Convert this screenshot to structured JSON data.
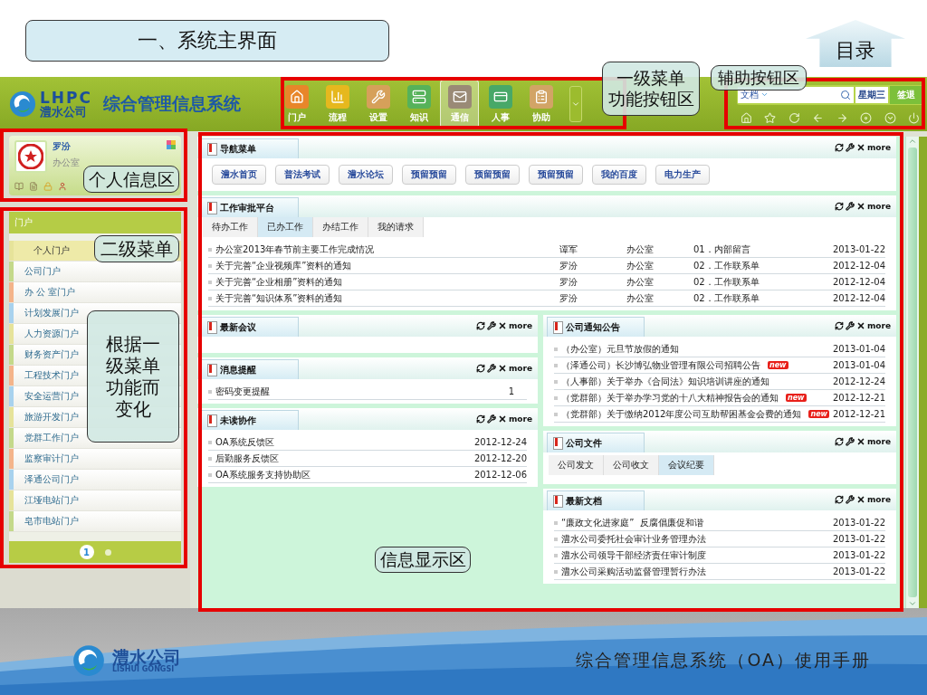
{
  "slide": {
    "title": "一、系统主界面",
    "toc": "目录"
  },
  "app": {
    "logo": {
      "mark": "LHPC",
      "name": "澧水公司"
    },
    "title": "综合管理信息系统",
    "main_menu": [
      {
        "label": "门户",
        "color": "#e8862a",
        "selected": false
      },
      {
        "label": "流程",
        "color": "#e6b81e",
        "selected": false
      },
      {
        "label": "设置",
        "color": "#d6a05a",
        "selected": false
      },
      {
        "label": "知识",
        "color": "#56b25a",
        "selected": false
      },
      {
        "label": "通信",
        "color": "#9a8a76",
        "selected": true
      },
      {
        "label": "人事",
        "color": "#48a868",
        "selected": false
      },
      {
        "label": "协助",
        "color": "#d2a466",
        "selected": false
      }
    ],
    "tools": {
      "search_scope": "文档",
      "weekday": "星期三",
      "sign_out": "签退"
    },
    "user": {
      "name": "罗汾",
      "department": "办公室"
    },
    "side_menu": {
      "title": "门户",
      "items": [
        {
          "label": "个人门户",
          "selected": true,
          "color": "#e6e39a"
        },
        {
          "label": "公司门户",
          "selected": false,
          "color": "#c4d98a"
        },
        {
          "label": "办 公 室门户",
          "selected": false,
          "color": "#f4b48a"
        },
        {
          "label": "计划发展门户",
          "selected": false,
          "color": "#a8d2ee"
        },
        {
          "label": "人力资源门户",
          "selected": false,
          "color": "#e6e39a"
        },
        {
          "label": "财务资产门户",
          "selected": false,
          "color": "#c4d98a"
        },
        {
          "label": "工程技术门户",
          "selected": false,
          "color": "#f4b48a"
        },
        {
          "label": "安全运营门户",
          "selected": false,
          "color": "#a8d2ee"
        },
        {
          "label": "旅游开发门户",
          "selected": false,
          "color": "#e6e39a"
        },
        {
          "label": "党群工作门户",
          "selected": false,
          "color": "#c4d98a"
        },
        {
          "label": "监察审计门户",
          "selected": false,
          "color": "#f4b48a"
        },
        {
          "label": "泽通公司门户",
          "selected": false,
          "color": "#a8d2ee"
        },
        {
          "label": "江垭电站门户",
          "selected": false,
          "color": "#e6e39a"
        },
        {
          "label": "皂市电站门户",
          "selected": false,
          "color": "#c4d98a"
        }
      ],
      "pages": [
        {
          "label": "1",
          "selected": true
        },
        {
          "selected": false
        }
      ]
    },
    "panels": {
      "nav": {
        "title": "导航菜单",
        "more": "more",
        "links": [
          "澧水首页",
          "普法考试",
          "澧水论坛",
          "预留预留",
          "预留预留",
          "预留预留",
          "我的百度",
          "电力生产"
        ]
      },
      "approval": {
        "title": "工作审批平台",
        "more": "more",
        "tabs": [
          {
            "label": "待办工作",
            "selected": false
          },
          {
            "label": "已办工作",
            "selected": true
          },
          {
            "label": "办结工作",
            "selected": false
          },
          {
            "label": "我的请求",
            "selected": false
          }
        ],
        "rows": [
          {
            "title": "办公室2013年春节前主要工作完成情况",
            "sender": "谭军",
            "department": "办公室",
            "type": "01．内部留言",
            "date": "2013-01-22"
          },
          {
            "title": "关于完善“企业视频库”资料的通知",
            "sender": "罗汾",
            "department": "办公室",
            "type": "02．工作联系单",
            "date": "2012-12-04"
          },
          {
            "title": "关于完善“企业相册”资料的通知",
            "sender": "罗汾",
            "department": "办公室",
            "type": "02．工作联系单",
            "date": "2012-12-04"
          },
          {
            "title": "关于完善“知识体系”资料的通知",
            "sender": "罗汾",
            "department": "办公室",
            "type": "02．工作联系单",
            "date": "2012-12-04"
          }
        ]
      },
      "meetings": {
        "title": "最新会议",
        "more": "more"
      },
      "reminders": {
        "title": "消息提醒",
        "more": "more",
        "rows": [
          {
            "title": "密码变更提醒",
            "count": "1"
          }
        ]
      },
      "collab": {
        "title": "未读协作",
        "more": "more",
        "rows": [
          {
            "title": "OA系统反馈区",
            "date": "2012-12-24"
          },
          {
            "title": "后勤服务反馈区",
            "date": "2012-12-20"
          },
          {
            "title": "OA系统服务支持协助区",
            "date": "2012-12-06"
          }
        ]
      },
      "notices": {
        "title": "公司通知公告",
        "more": "more",
        "rows": [
          {
            "title": "（办公室）元旦节放假的通知",
            "date": "2013-01-04"
          },
          {
            "title": "（泽通公司）长沙博弘物业管理有限公司招聘公告",
            "badge": "new",
            "date": "2013-01-04"
          },
          {
            "title": "（人事部）关于举办《合同法》知识培训讲座的通知",
            "date": "2012-12-24"
          },
          {
            "title": "（党群部）关于举办学习党的十八大精神报告会的通知",
            "badge": "new",
            "date": "2012-12-21"
          },
          {
            "title": "（党群部）关于缴纳2012年度公司互助帮困基金会费的通知",
            "badge": "new",
            "date": "2012-12-21"
          }
        ]
      },
      "files": {
        "title": "公司文件",
        "more": "more",
        "tabs": [
          {
            "label": "公司发文",
            "selected": false
          },
          {
            "label": "公司收文",
            "selected": false
          },
          {
            "label": "会议纪要",
            "selected": true
          }
        ]
      },
      "docs": {
        "title": "最新文档",
        "more": "more",
        "rows": [
          {
            "title": "“廉政文化进家庭”  反腐倡廉促和谐",
            "date": "2013-01-22"
          },
          {
            "title": "澧水公司委托社会审计业务管理办法",
            "date": "2013-01-22"
          },
          {
            "title": "澧水公司领导干部经济责任审计制度",
            "date": "2013-01-22"
          },
          {
            "title": "澧水公司采购活动监督管理暂行办法",
            "date": "2013-01-22"
          }
        ]
      }
    }
  },
  "annotations": [
    {
      "lines": [
        "一级菜单",
        "功能按钮区"
      ]
    },
    {
      "text": "辅助按钮区"
    },
    {
      "text": "个人信息区"
    },
    {
      "text": "二级菜单"
    },
    {
      "text": "根据一级菜单功能而变化"
    },
    {
      "text": "信息显示区"
    }
  ],
  "footer": {
    "company": "澧水公司",
    "company_en": "LISHUI GONGSI",
    "caption": "综合管理信息系统（OA）使用手册"
  }
}
